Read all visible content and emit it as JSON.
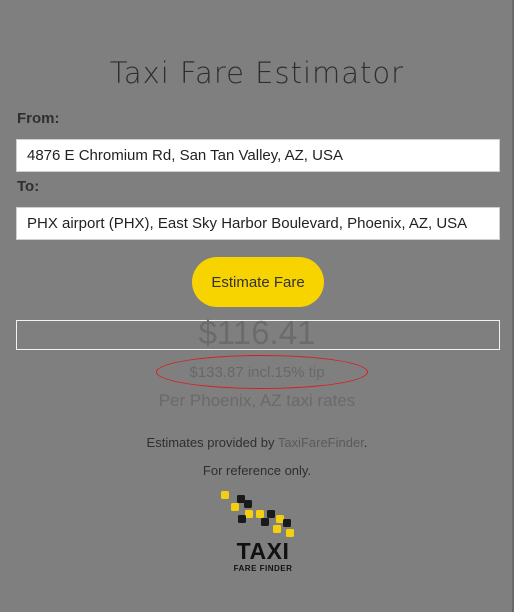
{
  "title": "Taxi Fare Estimator",
  "form": {
    "from_label": "From:",
    "from_value": "4876 E Chromium Rd, San Tan Valley, AZ, USA",
    "to_label": "To:",
    "to_value": "PHX airport (PHX), East Sky Harbor Boulevard, Phoenix, AZ, USA",
    "estimate_button": "Estimate Fare"
  },
  "result": {
    "fare": "$116.41",
    "tip_text": "$133.87 incl.15% tip",
    "rates_text": "Per Phoenix, AZ taxi rates"
  },
  "footer": {
    "provided_prefix": "Estimates provided by ",
    "provider_link": "TaxiFareFinder",
    "provided_suffix": ".",
    "reference": "For reference only."
  },
  "logo": {
    "word": "TAXI",
    "sub": "FARE FINDER"
  },
  "colors": {
    "background": "#7f7f7f",
    "button": "#f7d300",
    "annotation": "#d81f1f"
  }
}
